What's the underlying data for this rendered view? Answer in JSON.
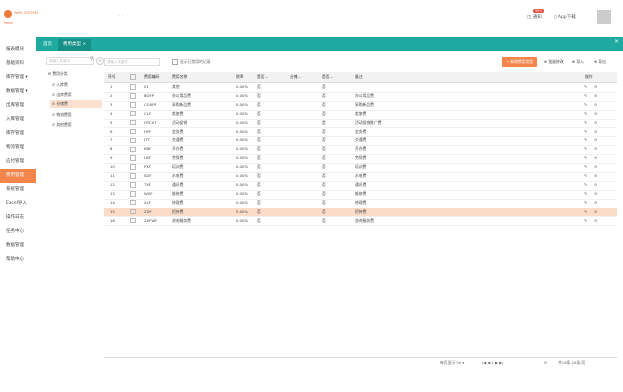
{
  "app": {
    "brand": "WMS SYSTEM",
    "brand_sub": "Mess",
    "dots": "·  ·"
  },
  "header": {
    "msg_label": "通知",
    "msg_badge": "99+",
    "app_label": "App下载"
  },
  "sidebar": {
    "items": [
      {
        "label": "报表模块"
      },
      {
        "label": "基础资料"
      },
      {
        "label": "库存管理 ▾"
      },
      {
        "label": "数据管理 ▾"
      },
      {
        "label": "出库管理"
      },
      {
        "label": "入库管理"
      },
      {
        "label": "库存管理"
      },
      {
        "label": "物流管理"
      },
      {
        "label": "应付管理"
      },
      {
        "label": "费用管理"
      },
      {
        "label": "系统管理"
      },
      {
        "label": "Excel导入"
      },
      {
        "label": "操作日志"
      },
      {
        "label": "任务中心"
      },
      {
        "label": "数据管理"
      },
      {
        "label": "帮助中心"
      }
    ]
  },
  "tabs": {
    "home": "首页",
    "current": "费用类型 ×",
    "close": "×"
  },
  "tree": {
    "search_placeholder": "请输入关键字",
    "plus": "+",
    "root": "⊟ 费用分类",
    "nodes": [
      {
        "label": "⊙ 入库费"
      },
      {
        "label": "⊙ 出库费用"
      },
      {
        "label": "⊙ 仓储费"
      },
      {
        "label": "⊙ 物流费用"
      },
      {
        "label": "⊙ 其他费用"
      }
    ]
  },
  "toolbar": {
    "filter_placeholder": "请输入关键字",
    "show_disabled": "显示已禁用的记录",
    "add_label": "+ 新增费用类型",
    "btn_edit": "⊕ 批量修改",
    "btn_import": "⊕ 导入",
    "btn_export": "⊕ 导出"
  },
  "table": {
    "headers": [
      "序号",
      "",
      "费用编码",
      "费用名称",
      "税率",
      "是否...",
      "分摊...",
      "是否...",
      "",
      "备注",
      "操作"
    ],
    "rows": [
      {
        "no": "1",
        "code": "01",
        "name": "其他",
        "tax": "0.00%",
        "a": "否",
        "b": "",
        "c": "否",
        "note": ""
      },
      {
        "no": "2",
        "code": "BGYP",
        "name": "办公用品费",
        "tax": "0.00%",
        "a": "否",
        "b": "",
        "c": "否",
        "note": "办公用品费"
      },
      {
        "no": "3",
        "code": "CGXPF",
        "name": "采购新品费",
        "tax": "0.00%",
        "a": "否",
        "b": "",
        "c": "否",
        "note": "采购新品费"
      },
      {
        "no": "4",
        "code": "CLF",
        "name": "差旅费",
        "tax": "0.00%",
        "a": "否",
        "b": "",
        "c": "否",
        "note": "差旅费"
      },
      {
        "no": "5",
        "code": "HTCXT",
        "name": "活动促销",
        "tax": "0.00%",
        "a": "否",
        "b": "",
        "c": "是",
        "note": "活动促销推广费"
      },
      {
        "no": "6",
        "code": "HYF",
        "name": "会务费",
        "tax": "0.00%",
        "a": "否",
        "b": "",
        "c": "否",
        "note": "会务费"
      },
      {
        "no": "7",
        "code": "JTF",
        "name": "交通费",
        "tax": "0.00%",
        "a": "否",
        "b": "",
        "c": "否",
        "note": "交通费"
      },
      {
        "no": "8",
        "code": "KBF",
        "name": "开办费",
        "tax": "0.00%",
        "a": "否",
        "b": "",
        "c": "否",
        "note": "开办费"
      },
      {
        "no": "9",
        "code": "LBF",
        "name": "劳保费",
        "tax": "0.00%",
        "a": "否",
        "b": "",
        "c": "否",
        "note": "劳保费"
      },
      {
        "no": "10",
        "code": "PXF",
        "name": "培训费",
        "tax": "0.00%",
        "a": "否",
        "b": "",
        "c": "否",
        "note": "培训费"
      },
      {
        "no": "11",
        "code": "SDF",
        "name": "水电费",
        "tax": "0.00%",
        "a": "否",
        "b": "",
        "c": "否",
        "note": "水电费"
      },
      {
        "no": "12",
        "code": "TXF",
        "name": "通讯费",
        "tax": "0.00%",
        "a": "否",
        "b": "",
        "c": "否",
        "note": "通讯费"
      },
      {
        "no": "13",
        "code": "WXF",
        "name": "维修费",
        "tax": "0.00%",
        "a": "否",
        "b": "",
        "c": "否",
        "note": "维修费"
      },
      {
        "no": "14",
        "code": "XLF",
        "name": "修理费",
        "tax": "0.00%",
        "a": "否",
        "b": "",
        "c": "否",
        "note": "修理费"
      },
      {
        "no": "15",
        "code": "ZDF",
        "name": "招待费",
        "tax": "0.00%",
        "a": "否",
        "b": "",
        "c": "否",
        "note": "招待费"
      },
      {
        "no": "16",
        "code": "ZXFWF",
        "name": "咨询服务费",
        "tax": "0.00%",
        "a": "否",
        "b": "",
        "c": "否",
        "note": "咨询服务费"
      }
    ]
  },
  "pager": {
    "page_size": "每页显示 50 ▾",
    "nav": "|◀  ◀   1   ▶  ▶|",
    "refresh": "⟳",
    "summary": "共16条 16条/页"
  }
}
